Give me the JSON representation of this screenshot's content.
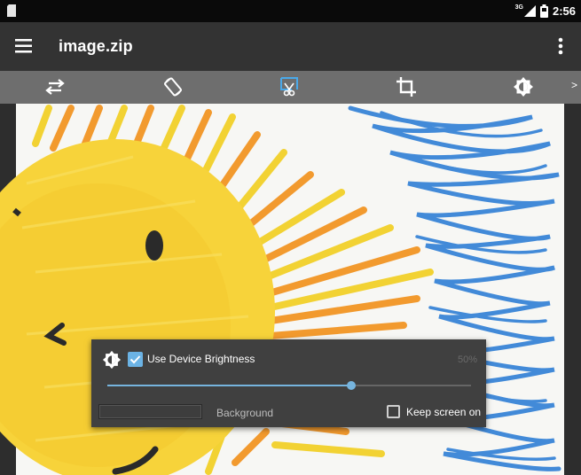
{
  "status_bar": {
    "network": "3G",
    "time": "2:56"
  },
  "app_bar": {
    "title": "image.zip"
  },
  "toolbar": {
    "tools": [
      "swap-icon",
      "rotate-screen-icon",
      "crop-free-icon",
      "crop-icon",
      "brightness-icon"
    ],
    "more_label": ">"
  },
  "dialog": {
    "use_device_brightness_label": "Use Device Brightness",
    "use_device_brightness_checked": true,
    "brightness_percent": "50%",
    "brightness_level": 0.67,
    "background_label": "Background",
    "keep_screen_on_label": "Keep screen on",
    "keep_screen_on_checked": false
  },
  "colors": {
    "accent": "#76b4de",
    "app_bar": "#333333",
    "toolbar": "#6e6e6e",
    "dialog": "#404040"
  }
}
